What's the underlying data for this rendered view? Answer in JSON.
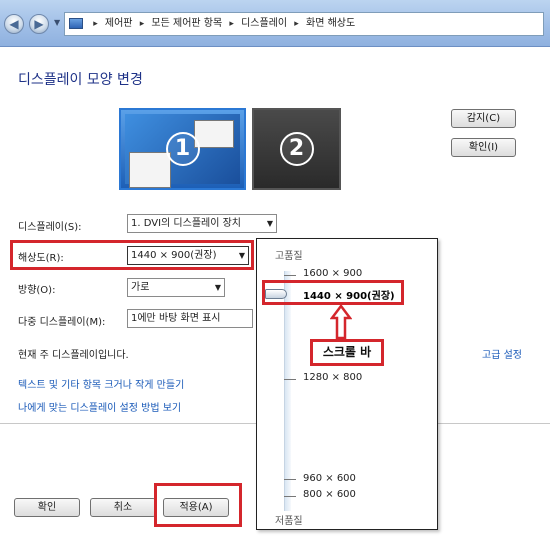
{
  "breadcrumb": {
    "items": [
      "제어판",
      "모든 제어판 항목",
      "디스플레이",
      "화면 해상도"
    ]
  },
  "page": {
    "title": "디스플레이 모양 변경",
    "monitor_1_label": "1",
    "monitor_2_label": "2"
  },
  "buttons": {
    "detect": "감지(C)",
    "identify": "확인(I)",
    "ok": "확인",
    "cancel": "취소",
    "apply": "적용(A)"
  },
  "fields": {
    "display": {
      "label": "디스플레이(S):",
      "value": "1. DVI의 디스플레이 장치"
    },
    "resolution": {
      "label": "해상도(R):",
      "value": "1440 × 900(권장)"
    },
    "orientation": {
      "label": "방향(O):",
      "value": "가로"
    },
    "multiple": {
      "label": "다중 디스플레이(M):",
      "value": "1에만 바탕 화면 표시"
    }
  },
  "status": {
    "current_display": "현재 주 디스플레이입니다.",
    "advanced_link": "고급 설정"
  },
  "links": {
    "text_size": "텍스트 및 기타 항목 크거나 작게 만들기",
    "help": "나에게 맞는 디스플레이 설정 방법 보기"
  },
  "resolution_panel": {
    "high_label": "고품질",
    "low_label": "저품질",
    "options": [
      "1600 × 900",
      "1440 × 900(권장)",
      "1280 × 800",
      "960 × 600",
      "800 × 600"
    ],
    "selected": "1440 × 900(권장)"
  },
  "annotation": {
    "scrollbar_label": "스크롤 바"
  },
  "colors": {
    "title_blue": "#1e3287",
    "link_blue": "#1a5ab8",
    "highlight_red": "#d4262c",
    "selected_monitor": "#2b78d4"
  },
  "icons": [
    "back-arrow-icon",
    "forward-arrow-icon",
    "control-panel-icon",
    "dropdown-arrow-icon",
    "slider-thumb-icon",
    "up-arrow-icon"
  ]
}
